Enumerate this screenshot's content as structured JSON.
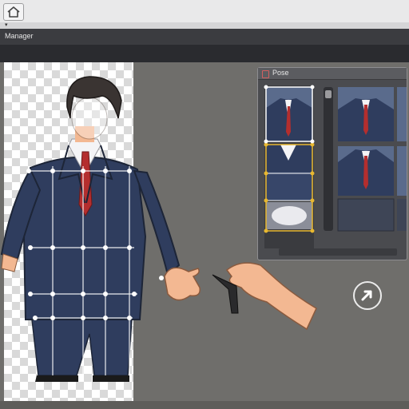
{
  "app": {
    "title": "Manager",
    "tab_mark": "▾"
  },
  "pose_window": {
    "title": "Pose"
  },
  "colors": {
    "canvas_bg": "#6f6e6b",
    "suit": "#2f3d5e",
    "tie": "#b42e2e",
    "skin": "#f3b892",
    "hair": "#3a3432",
    "selection": "#e8b830",
    "grid_line": "#ffffff"
  },
  "icons": {
    "home": "home-icon",
    "pose": "pose-window-icon",
    "next": "arrow-next-icon"
  }
}
